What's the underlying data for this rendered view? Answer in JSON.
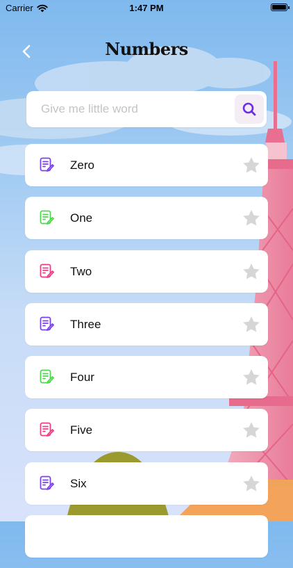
{
  "status_bar": {
    "carrier": "Carrier",
    "time": "1:47 PM"
  },
  "header": {
    "title": "Numbers"
  },
  "search": {
    "placeholder": "Give me little word"
  },
  "items": [
    {
      "label": "Zero",
      "icon_color": "#7b3ff2"
    },
    {
      "label": "One",
      "icon_color": "#4ed74e"
    },
    {
      "label": "Two",
      "icon_color": "#ee3d86"
    },
    {
      "label": "Three",
      "icon_color": "#7b3ff2"
    },
    {
      "label": "Four",
      "icon_color": "#4ed74e"
    },
    {
      "label": "Five",
      "icon_color": "#ee3d86"
    },
    {
      "label": "Six",
      "icon_color": "#7b3ff2"
    },
    {
      "label": "",
      "icon_color": "#4ed74e"
    }
  ],
  "colors": {
    "star": "#d6d6d6",
    "search_icon": "#6a2fe0"
  }
}
